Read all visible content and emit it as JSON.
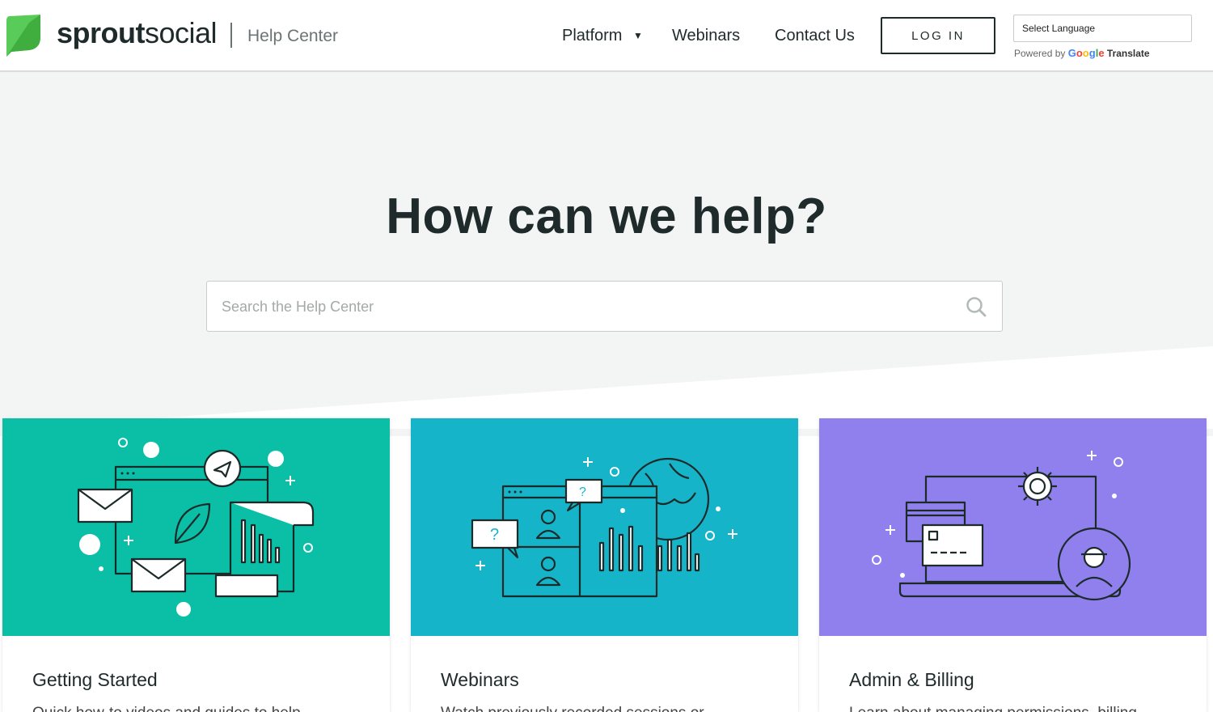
{
  "header": {
    "logo": {
      "bold": "sprout",
      "light": "social"
    },
    "section_title": "Help Center",
    "nav": [
      {
        "label": "Platform",
        "has_dropdown": true
      },
      {
        "label": "Webinars"
      },
      {
        "label": "Contact Us"
      }
    ],
    "login_label": "LOG IN",
    "language_select": "Select Language",
    "powered_by": "Powered by",
    "google": "Google",
    "translate": "Translate"
  },
  "hero": {
    "title": "How can we help?",
    "search_placeholder": "Search the Help Center"
  },
  "cards": [
    {
      "title": "Getting Started",
      "description": "Quick how-to videos and guides to help",
      "color": "#0abfa6"
    },
    {
      "title": "Webinars",
      "description": "Watch previously recorded sessions or",
      "color": "#16b4c9"
    },
    {
      "title": "Admin & Billing",
      "description": "Learn about managing permissions, billing",
      "color": "#8f80ee"
    }
  ],
  "colors": {
    "brand_green": "#59cb59",
    "dark_text": "#1f2a2a",
    "hero_bg": "#f3f4f4"
  }
}
